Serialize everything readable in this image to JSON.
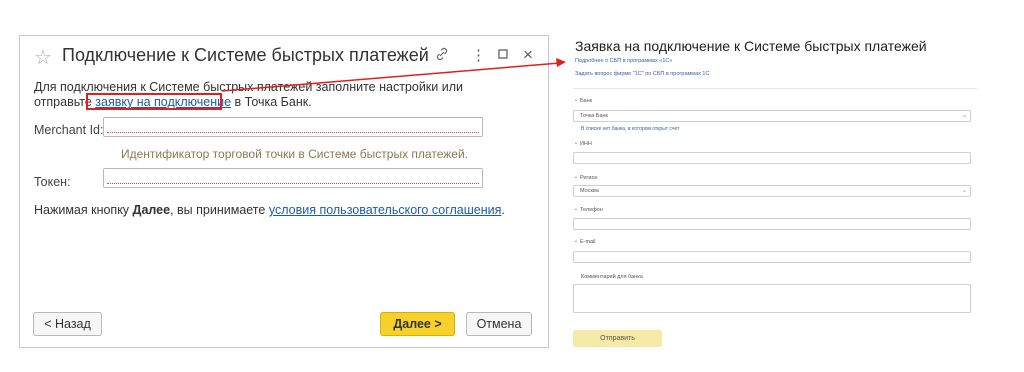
{
  "dialog": {
    "title": "Подключение к Системе быстрых платежей",
    "icons": {
      "star": "star-icon",
      "link": "link-icon",
      "more": "more-icon",
      "maximize": "maximize-icon",
      "close": "close-icon"
    },
    "intro_before": "Для подключения к Системе быстрых платежей заполните настройки или отправьте ",
    "intro_link": "заявку на подключение",
    "intro_after": " в Точка Банк.",
    "merchant_label": "Merchant Id:",
    "merchant_value": "",
    "merchant_hint": "Идентификатор торговой точки в Системе быстрых платежей.",
    "token_label": "Токен:",
    "token_value": "",
    "agree_before": "Нажимая кнопку ",
    "agree_bold": "Далее",
    "agree_middle": ", вы принимаете ",
    "agree_link": "условия пользовательского соглашения",
    "agree_after": ".",
    "back_label": "< Назад",
    "next_label": "Далее >",
    "cancel_label": "Отмена",
    "accent_color": "#f7d12b",
    "highlight_color": "#e02020"
  },
  "web_form": {
    "title": "Заявка на подключение к Системе быстрых платежей",
    "link1": "Подробнее о СБП в программах «1С»",
    "link2": "Задать вопрос фирме \"1С\" по СБП в программах 1С",
    "bank_label": "Банк",
    "bank_value": "Точка Банк",
    "bank_note": "В списке нет банка, в котором открыт счет",
    "inn_label": "ИНН",
    "inn_value": "",
    "region_label": "Регион",
    "region_value": "Москва",
    "phone_label": "Телефон",
    "phone_value": "",
    "email_label": "E-mail",
    "email_value": "",
    "comment_label": "Комментарий для банка",
    "comment_value": "",
    "submit_label": "Отправить",
    "required_mark": "•"
  }
}
